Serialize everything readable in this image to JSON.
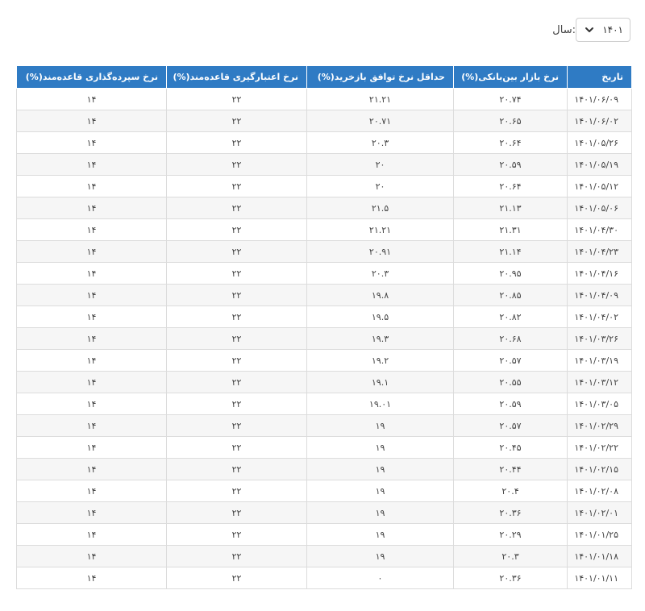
{
  "filter": {
    "year_label": "سال:",
    "year_value": "۱۴۰۱",
    "chevron_icon": "chevron-down-icon"
  },
  "colors": {
    "header_bg": "#2f7bc4",
    "header_text": "#ffffff",
    "row_alt": "#f6f6f6"
  },
  "table": {
    "columns": [
      "تاریخ",
      "نرخ بازار بین‌بانکی(%)",
      "حداقل نرخ توافق بازخرید(%)",
      "نرخ اعتبارگیری قاعده‌مند(%)",
      "نرخ سپرده‌گذاری قاعده‌مند(%)"
    ],
    "rows": [
      [
        "۱۴۰۱/۰۶/۰۹",
        "۲۰.۷۴",
        "۲۱.۲۱",
        "۲۲",
        "۱۴"
      ],
      [
        "۱۴۰۱/۰۶/۰۲",
        "۲۰.۶۵",
        "۲۰.۷۱",
        "۲۲",
        "۱۴"
      ],
      [
        "۱۴۰۱/۰۵/۲۶",
        "۲۰.۶۴",
        "۲۰.۳",
        "۲۲",
        "۱۴"
      ],
      [
        "۱۴۰۱/۰۵/۱۹",
        "۲۰.۵۹",
        "۲۰",
        "۲۲",
        "۱۴"
      ],
      [
        "۱۴۰۱/۰۵/۱۲",
        "۲۰.۶۴",
        "۲۰",
        "۲۲",
        "۱۴"
      ],
      [
        "۱۴۰۱/۰۵/۰۶",
        "۲۱.۱۳",
        "۲۱.۵",
        "۲۲",
        "۱۴"
      ],
      [
        "۱۴۰۱/۰۴/۳۰",
        "۲۱.۳۱",
        "۲۱.۲۱",
        "۲۲",
        "۱۴"
      ],
      [
        "۱۴۰۱/۰۴/۲۳",
        "۲۱.۱۴",
        "۲۰.۹۱",
        "۲۲",
        "۱۴"
      ],
      [
        "۱۴۰۱/۰۴/۱۶",
        "۲۰.۹۵",
        "۲۰.۳",
        "۲۲",
        "۱۴"
      ],
      [
        "۱۴۰۱/۰۴/۰۹",
        "۲۰.۸۵",
        "۱۹.۸",
        "۲۲",
        "۱۴"
      ],
      [
        "۱۴۰۱/۰۴/۰۲",
        "۲۰.۸۲",
        "۱۹.۵",
        "۲۲",
        "۱۴"
      ],
      [
        "۱۴۰۱/۰۳/۲۶",
        "۲۰.۶۸",
        "۱۹.۳",
        "۲۲",
        "۱۴"
      ],
      [
        "۱۴۰۱/۰۳/۱۹",
        "۲۰.۵۷",
        "۱۹.۲",
        "۲۲",
        "۱۴"
      ],
      [
        "۱۴۰۱/۰۳/۱۲",
        "۲۰.۵۵",
        "۱۹.۱",
        "۲۲",
        "۱۴"
      ],
      [
        "۱۴۰۱/۰۳/۰۵",
        "۲۰.۵۹",
        "۱۹.۰۱",
        "۲۲",
        "۱۴"
      ],
      [
        "۱۴۰۱/۰۲/۲۹",
        "۲۰.۵۷",
        "۱۹",
        "۲۲",
        "۱۴"
      ],
      [
        "۱۴۰۱/۰۲/۲۲",
        "۲۰.۴۵",
        "۱۹",
        "۲۲",
        "۱۴"
      ],
      [
        "۱۴۰۱/۰۲/۱۵",
        "۲۰.۴۴",
        "۱۹",
        "۲۲",
        "۱۴"
      ],
      [
        "۱۴۰۱/۰۲/۰۸",
        "۲۰.۴",
        "۱۹",
        "۲۲",
        "۱۴"
      ],
      [
        "۱۴۰۱/۰۲/۰۱",
        "۲۰.۳۶",
        "۱۹",
        "۲۲",
        "۱۴"
      ],
      [
        "۱۴۰۱/۰۱/۲۵",
        "۲۰.۲۹",
        "۱۹",
        "۲۲",
        "۱۴"
      ],
      [
        "۱۴۰۱/۰۱/۱۸",
        "۲۰.۳",
        "۱۹",
        "۲۲",
        "۱۴"
      ],
      [
        "۱۴۰۱/۰۱/۱۱",
        "۲۰.۳۶",
        "۰",
        "۲۲",
        "۱۴"
      ]
    ]
  }
}
